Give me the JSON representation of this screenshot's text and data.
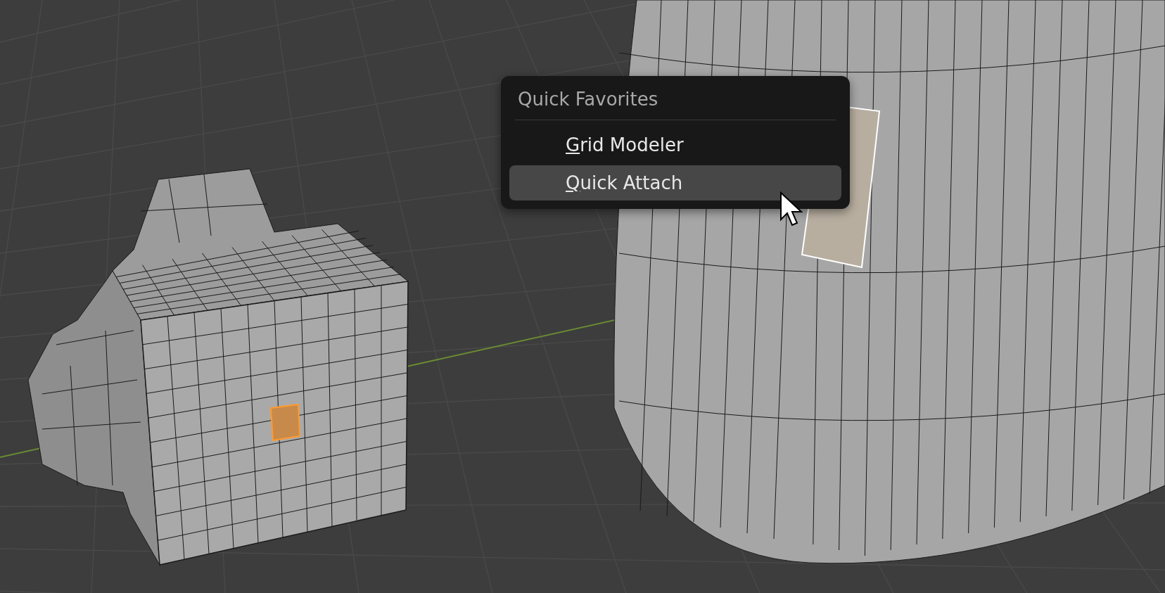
{
  "menu": {
    "title": "Quick Favorites",
    "items": [
      {
        "label": "Grid Modeler",
        "selected": false,
        "underline_first": true
      },
      {
        "label": "Quick Attach",
        "selected": true,
        "underline_first": true
      }
    ]
  }
}
